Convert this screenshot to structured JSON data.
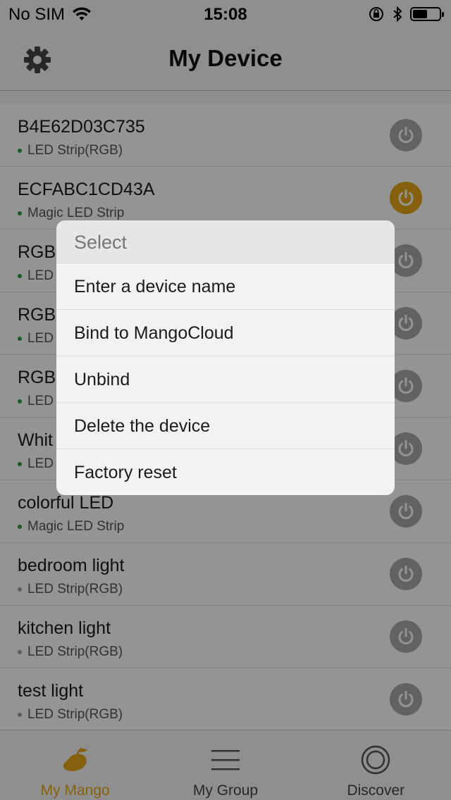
{
  "status_bar": {
    "carrier": "No SIM",
    "time": "15:08"
  },
  "nav": {
    "title": "My Device",
    "settings_icon": "gear-icon"
  },
  "colors": {
    "accent": "#e6a817",
    "power_off": "#a9a9a9",
    "power_on": "#e6a817",
    "online_dot": "#2e9e3a",
    "offline_dot": "#a0a0a0"
  },
  "devices": [
    {
      "name": "B4E62D03C735",
      "type": "LED Strip(RGB)",
      "online": true,
      "on": false
    },
    {
      "name": "ECFABC1CD43A",
      "type": "Magic LED Strip",
      "online": true,
      "on": true
    },
    {
      "name": "RGB",
      "type": "LED",
      "online": true,
      "on": false
    },
    {
      "name": "RGB",
      "type": "LED",
      "online": true,
      "on": false
    },
    {
      "name": "RGB",
      "type": "LED",
      "online": true,
      "on": false
    },
    {
      "name": "Whit",
      "type": "LED",
      "online": true,
      "on": false
    },
    {
      "name": "colorful LED",
      "type": "Magic LED Strip",
      "online": true,
      "on": false
    },
    {
      "name": "bedroom light",
      "type": "LED Strip(RGB)",
      "online": false,
      "on": false
    },
    {
      "name": "kitchen light",
      "type": "LED Strip(RGB)",
      "online": false,
      "on": false
    },
    {
      "name": "test light",
      "type": "LED Strip(RGB)",
      "online": false,
      "on": false
    }
  ],
  "dialog": {
    "title": "Select",
    "options": [
      "Enter a device name",
      "Bind to MangoCloud",
      "Unbind",
      "Delete the device",
      "Factory reset"
    ]
  },
  "tabs": [
    {
      "label": "My Mango",
      "icon": "mango-icon",
      "active": true
    },
    {
      "label": "My Group",
      "icon": "menu-lines-icon",
      "active": false
    },
    {
      "label": "Discover",
      "icon": "target-circle-icon",
      "active": false
    }
  ]
}
